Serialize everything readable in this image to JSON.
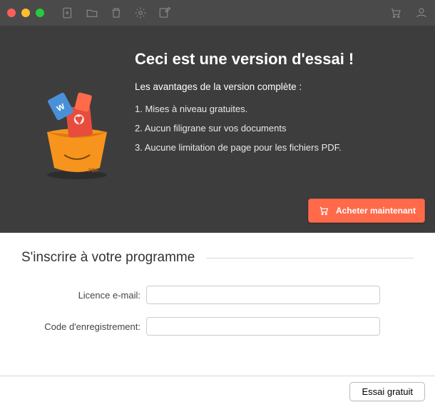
{
  "toolbar": {
    "icons": [
      "add-doc",
      "folder",
      "trash",
      "settings",
      "edit"
    ],
    "right_icons": [
      "cart",
      "account"
    ]
  },
  "hero": {
    "title": "Ceci est une version d'essai !",
    "subtitle": "Les avantages de la version complète :",
    "items": [
      "1. Mises à niveau gratuites.",
      "2. Aucun filigrane sur vos documents",
      "3. Aucune limitation de page pour les fichiers PDF."
    ],
    "buy_label": "Acheter maintenant"
  },
  "register": {
    "heading": "S'inscrire à votre programme",
    "email_label": "Licence e-mail:",
    "code_label": "Code d'enregistrement:"
  },
  "footer": {
    "trial_label": "Essai gratuit"
  },
  "colors": {
    "accent": "#ff6a4b",
    "hero_bg": "#3d3d3d"
  }
}
